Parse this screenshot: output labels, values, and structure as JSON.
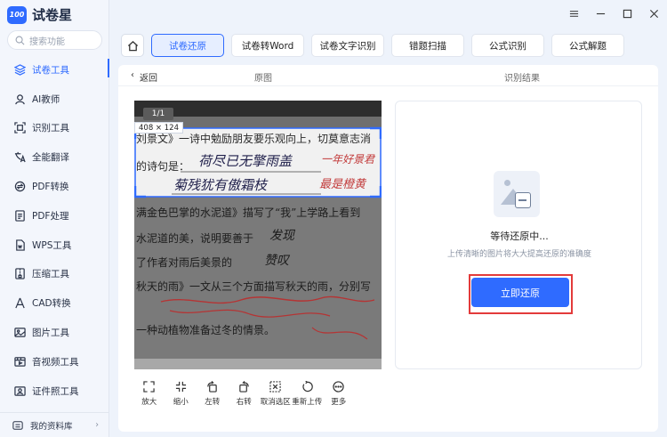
{
  "app": {
    "logo_mark": "100",
    "name": "试卷星",
    "search_placeholder": "搜索功能"
  },
  "sidebar": {
    "items": [
      {
        "label": "试卷工具",
        "icon": "layers-icon",
        "active": true
      },
      {
        "label": "AI教师",
        "icon": "teacher-icon"
      },
      {
        "label": "识别工具",
        "icon": "scan-icon"
      },
      {
        "label": "全能翻译",
        "icon": "translate-icon"
      },
      {
        "label": "PDF转换",
        "icon": "pdf-convert-icon"
      },
      {
        "label": "PDF处理",
        "icon": "pdf-process-icon"
      },
      {
        "label": "WPS工具",
        "icon": "wps-icon"
      },
      {
        "label": "压缩工具",
        "icon": "compress-icon"
      },
      {
        "label": "CAD转换",
        "icon": "cad-icon"
      },
      {
        "label": "图片工具",
        "icon": "image-icon"
      },
      {
        "label": "音视频工具",
        "icon": "media-icon"
      },
      {
        "label": "证件照工具",
        "icon": "id-photo-icon"
      }
    ],
    "footer_label": "我的资料库",
    "accent": "#2f6bff"
  },
  "tabs": [
    {
      "label": "试卷还原",
      "active": true
    },
    {
      "label": "试卷转Word"
    },
    {
      "label": "试卷文字识别"
    },
    {
      "label": "错题扫描"
    },
    {
      "label": "公式识别"
    },
    {
      "label": "公式解题"
    }
  ],
  "panel": {
    "back_label": "返回",
    "original_label": "原图",
    "result_label": "识别结果"
  },
  "preview": {
    "page_indicator": "1/1",
    "selection_size": "408 × 124",
    "lines": [
      "刘景文》一诗中勉励朋友要乐观向上，切莫意志消",
      "的诗句是：",
      "满金色巴掌的水泥道》描写了“我”上学路上看到",
      "水泥道的美，说明要善于",
      "了作者对雨后美景的",
      "秋天的雨》一文从三个方面描写秋天的雨，分别写",
      "一种动植物准备过冬的情景。"
    ],
    "handwriting": [
      "荷尽已无擎雨盖",
      "菊残犹有傲霜枝",
      "最是橙黄",
      "一年好景君",
      "发现",
      "赞叹"
    ]
  },
  "toolbar": [
    {
      "label": "放大",
      "icon": "zoom-in-icon"
    },
    {
      "label": "缩小",
      "icon": "zoom-out-icon"
    },
    {
      "label": "左转",
      "icon": "rotate-left-icon"
    },
    {
      "label": "右转",
      "icon": "rotate-right-icon"
    },
    {
      "label": "取消选区",
      "icon": "cancel-selection-icon"
    },
    {
      "label": "重新上传",
      "icon": "reupload-icon"
    },
    {
      "label": "更多",
      "icon": "more-icon"
    }
  ],
  "result": {
    "status": "等待还原中...",
    "tip": "上传清晰的图片将大大提高还原的准确度",
    "button_label": "立即还原",
    "highlight_color": "#e33b3b"
  }
}
